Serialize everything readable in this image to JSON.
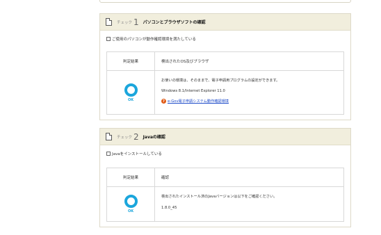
{
  "check1": {
    "check_word": "チェック",
    "number": "1",
    "title": "パソコンとブラウザソフトの確認",
    "checkbox_label": "ご使用のパソコンが動作確認環境を満たしている",
    "table": {
      "header_result": "判定結果",
      "header_detail": "検出されたOS及びブラウザ",
      "ok_label": "OK",
      "message": "お使いの環境は、そのままで、電子申請用プログラムの設定ができます。",
      "environment": "Windows 8.1/Internet Explorer 11.0",
      "help_icon": "question-icon",
      "help_link": "e-Gov電子申請システム動作確認環境"
    }
  },
  "check2": {
    "check_word": "チェック",
    "number": "2",
    "title": "Javaの確認",
    "checkbox_label": "Javaをインストールしている",
    "table": {
      "header_result": "判定結果",
      "header_detail": "確認",
      "ok_label": "OK",
      "message": "検出されたインストール済のJavaバージョンは以下をご確認ください。",
      "version": "1.8.0_45"
    }
  },
  "colors": {
    "ok_blue": "#1ba6dc",
    "header_bg": "#f1eedd",
    "link": "#1a48c8",
    "help_orange": "#e05a16"
  }
}
